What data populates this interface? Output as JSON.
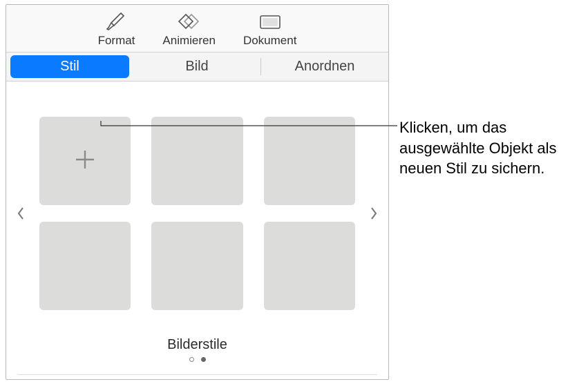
{
  "toolbar": {
    "format": "Format",
    "animate": "Animieren",
    "document": "Dokument"
  },
  "tabs": {
    "style": "Stil",
    "image": "Bild",
    "arrange": "Anordnen"
  },
  "styles": {
    "section_label": "Bilderstile"
  },
  "callout": {
    "text": "Klicken, um das ausgewählte Objekt als neuen Stil zu sichern."
  }
}
